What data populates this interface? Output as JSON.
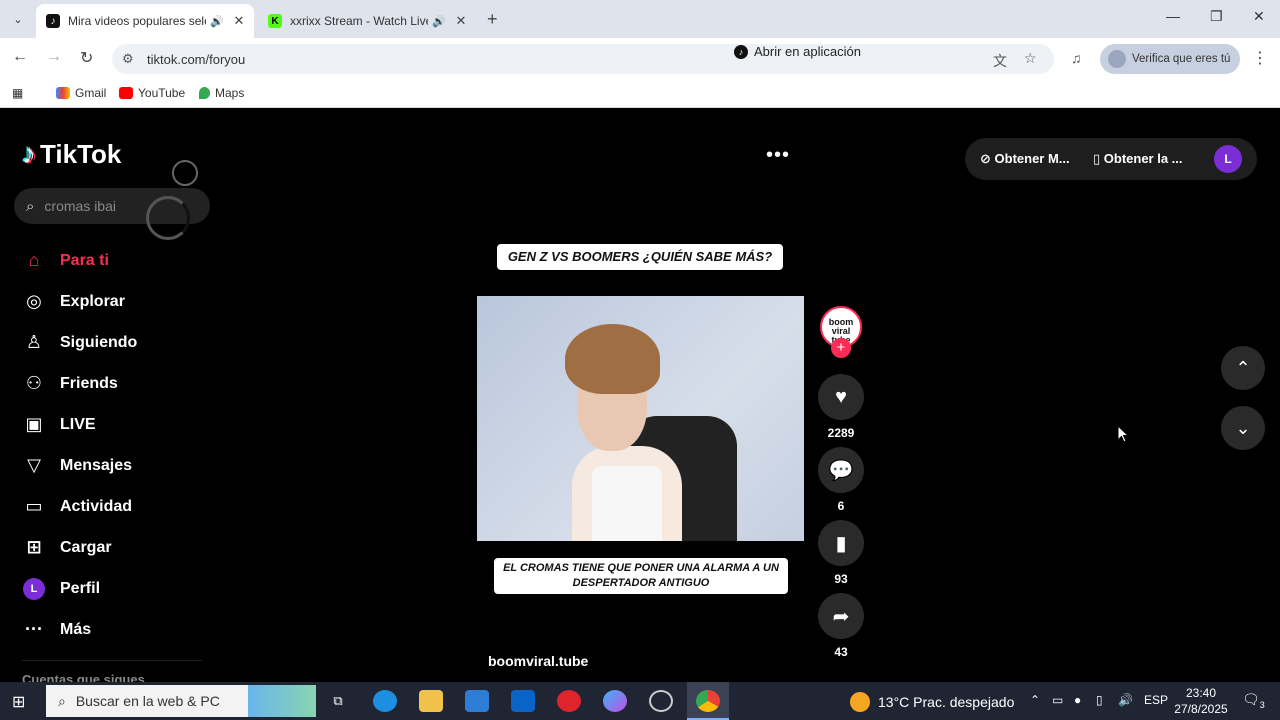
{
  "browser": {
    "tabs": [
      {
        "title": "Mira videos populares selec",
        "favicon": "tiktok-icon",
        "active": true
      },
      {
        "title": "xxrixx Stream - Watch Live o",
        "favicon": "kick-icon",
        "active": false
      }
    ],
    "url": "tiktok.com/foryou",
    "open_in_app": "Abrir en aplicación",
    "verify": "Verifica que eres tú",
    "bookmarks": [
      "Gmail",
      "YouTube",
      "Maps"
    ]
  },
  "tiktok": {
    "logo": "TikTok",
    "search_value": "cromas ibai",
    "nav": [
      {
        "label": "Para ti",
        "icon": "home-icon",
        "active": true
      },
      {
        "label": "Explorar",
        "icon": "compass-icon"
      },
      {
        "label": "Siguiendo",
        "icon": "following-icon"
      },
      {
        "label": "Friends",
        "icon": "friends-icon"
      },
      {
        "label": "LIVE",
        "icon": "live-icon"
      },
      {
        "label": "Mensajes",
        "icon": "messages-icon"
      },
      {
        "label": "Actividad",
        "icon": "activity-icon"
      },
      {
        "label": "Cargar",
        "icon": "upload-icon"
      },
      {
        "label": "Perfil",
        "icon": "profile-icon"
      },
      {
        "label": "Más",
        "icon": "more-icon"
      }
    ],
    "following_header": "Cuentas que sigues",
    "top_buttons": {
      "get_coins": "Obtener M...",
      "get_app": "Obtener la ...",
      "avatar_letter": "L"
    },
    "video": {
      "title_banner": "GEN Z VS BOOMERS ¿QUIÉN SABE MÁS?",
      "caption_banner": "EL CROMAS TIENE QUE PONER UNA ALARMA A UN DESPERTADOR ANTIGUO",
      "author": "boomviral.tube",
      "author_avatar_text": "boom viral tube"
    },
    "actions": {
      "likes": "2289",
      "comments": "6",
      "saves": "93",
      "shares": "43"
    }
  },
  "taskbar": {
    "search_placeholder": "Buscar en la web & PC",
    "weather": "13°C  Prac. despejado",
    "lang": "ESP",
    "time": "23:40",
    "date": "27/8/2025",
    "notifications": "3"
  },
  "colors": {
    "accent": "#fe2c55",
    "avatar_purple": "#7b2dd6"
  }
}
